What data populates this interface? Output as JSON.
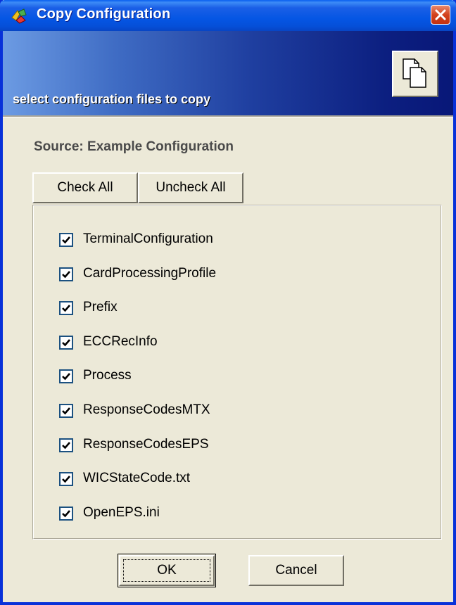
{
  "window": {
    "title": "Copy Configuration",
    "close_icon": "close-icon"
  },
  "header": {
    "subtitle": "select configuration files to copy",
    "icon": "copy-files-icon"
  },
  "source": {
    "label": "Source: Example Configuration"
  },
  "toolbar": {
    "check_all_label": "Check All",
    "uncheck_all_label": "Uncheck All"
  },
  "files": [
    {
      "label": "TerminalConfiguration",
      "checked": true
    },
    {
      "label": "CardProcessingProfile",
      "checked": true
    },
    {
      "label": "Prefix",
      "checked": true
    },
    {
      "label": "ECCRecInfo",
      "checked": true
    },
    {
      "label": "Process",
      "checked": true
    },
    {
      "label": "ResponseCodesMTX",
      "checked": true
    },
    {
      "label": "ResponseCodesEPS",
      "checked": true
    },
    {
      "label": "WICStateCode.txt",
      "checked": true
    },
    {
      "label": "OpenEPS.ini",
      "checked": true
    }
  ],
  "footer": {
    "ok_label": "OK",
    "cancel_label": "Cancel"
  },
  "colors": {
    "titlebar": "#0556e4",
    "dialog_bg": "#ece9d8",
    "close_button": "#d3421c"
  }
}
